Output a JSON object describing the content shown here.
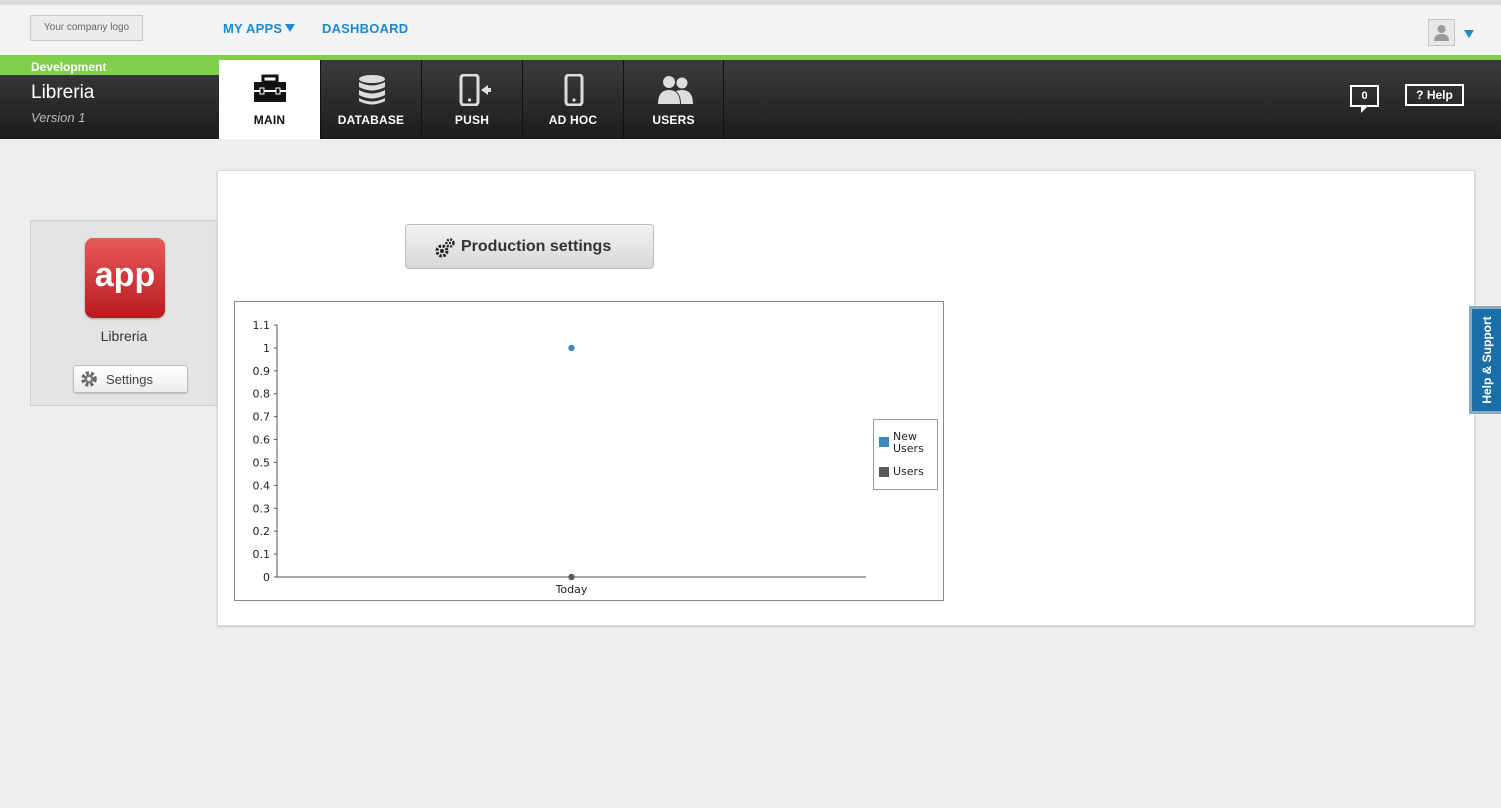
{
  "header": {
    "logo_text": "Your company logo",
    "nav": {
      "my_apps": "MY APPS",
      "dashboard": "DASHBOARD"
    },
    "icons": {
      "avatar": "user-icon",
      "caret": "chevron-down-icon"
    }
  },
  "appbar": {
    "environment": "Development",
    "app_name": "Libreria",
    "version": "Version 1",
    "tabs": [
      {
        "label": "MAIN",
        "icon": "toolbox-icon",
        "active": true
      },
      {
        "label": "DATABASE",
        "icon": "database-icon",
        "active": false
      },
      {
        "label": "PUSH",
        "icon": "push-icon",
        "active": false
      },
      {
        "label": "AD HOC",
        "icon": "phone-icon",
        "active": false
      },
      {
        "label": "USERS",
        "icon": "users-icon",
        "active": false
      }
    ],
    "notifications": "0",
    "help": "? Help",
    "accent": "#7fcf4b"
  },
  "app_card": {
    "icon_text": "app",
    "app_name": "Libreria",
    "settings_label": "Settings"
  },
  "main": {
    "production_settings_label": "Production settings"
  },
  "side_tab": "Help & Support",
  "chart_data": {
    "type": "scatter",
    "categories": [
      "Today"
    ],
    "series": [
      {
        "name": "New Users",
        "values": [
          1
        ],
        "color": "#3d87c1"
      },
      {
        "name": "Users",
        "values": [
          0
        ],
        "color": "#5a5a5a"
      }
    ],
    "yticks": [
      "0",
      "0.1",
      "0.2",
      "0.3",
      "0.4",
      "0.5",
      "0.6",
      "0.7",
      "0.8",
      "0.9",
      "1",
      "1.1"
    ],
    "ylim": [
      0,
      1.1
    ],
    "legend": "right"
  }
}
